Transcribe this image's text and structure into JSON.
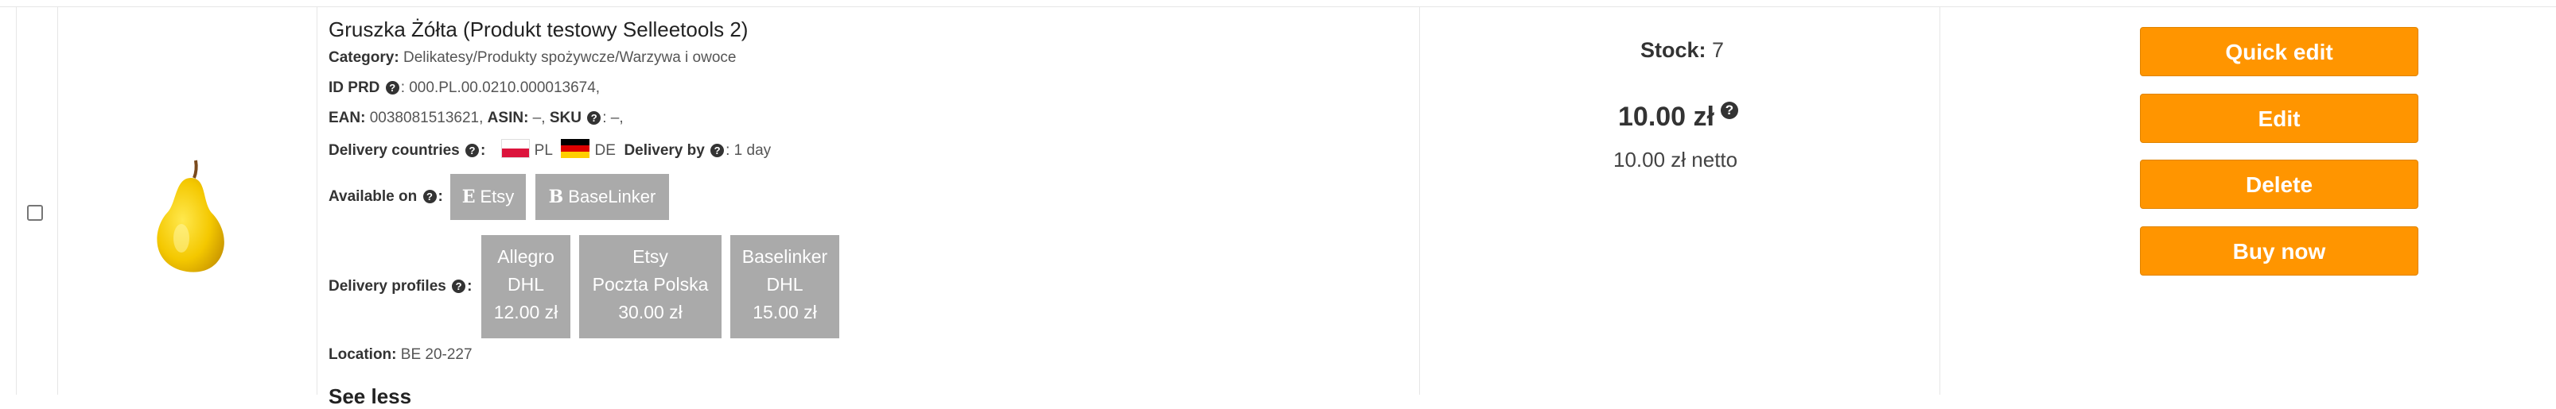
{
  "product": {
    "title": "Gruszka Żółta (Produkt testowy Selleetools 2)",
    "category_label": "Category:",
    "category_value": "Delikatesy/Produkty spożywcze/Warzywa i owoce",
    "id_label": "ID PRD",
    "id_value": ": 000.PL.00.0210.000013674,",
    "ean_label": "EAN:",
    "ean_value": " 0038081513621, ",
    "asin_label": "ASIN:",
    "asin_value": " –, ",
    "sku_label": "SKU",
    "sku_value": ": –,",
    "delivery_countries_label": "Delivery countries",
    "country_pl": "PL",
    "country_de": "DE",
    "delivery_by_label": "Delivery by",
    "delivery_by_value": ": 1 day",
    "available_on_label": "Available on",
    "marketplaces": [
      {
        "icon": "E",
        "name": "Etsy"
      },
      {
        "icon": "B",
        "name": "BaseLinker"
      }
    ],
    "delivery_profiles_label": "Delivery profiles",
    "delivery_profiles": [
      {
        "line1": "Allegro",
        "line2": "DHL",
        "price": "12.00 zł"
      },
      {
        "line1": "Etsy",
        "line2": "Poczta Polska",
        "price": "30.00 zł"
      },
      {
        "line1": "Baselinker",
        "line2": "DHL",
        "price": "15.00 zł"
      }
    ],
    "location_label": "Location:",
    "location_value": " BE 20-227",
    "see_less": "See less"
  },
  "stock": {
    "label": "Stock:",
    "value": " 7"
  },
  "price": {
    "gross": "10.00 zł",
    "netto": "10.00 zł netto"
  },
  "actions": {
    "quick_edit": "Quick edit",
    "edit": "Edit",
    "delete": "Delete",
    "buy_now": "Buy now"
  },
  "colors": {
    "accent": "#ff9500",
    "tag_bg": "#aaaaaa"
  }
}
